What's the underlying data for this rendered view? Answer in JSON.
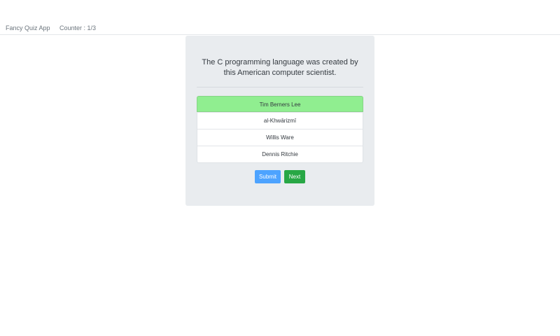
{
  "navbar": {
    "brand": "Fancy Quiz App",
    "counter": "Counter : 1/3"
  },
  "quiz": {
    "question": "The C programming language was created by this American computer scientist.",
    "answers": [
      {
        "label": "Tim Berners Lee",
        "selected": true
      },
      {
        "label": "al-Khwārizmī",
        "selected": false
      },
      {
        "label": "Willis Ware",
        "selected": false
      },
      {
        "label": "Dennis Ritchie",
        "selected": false
      }
    ],
    "submit_label": "Submit",
    "next_label": "Next"
  },
  "colors": {
    "selected_answer": "#90ee90",
    "submit_button": "#4da3ff",
    "next_button": "#28a745",
    "card_background": "#e9ecef"
  }
}
